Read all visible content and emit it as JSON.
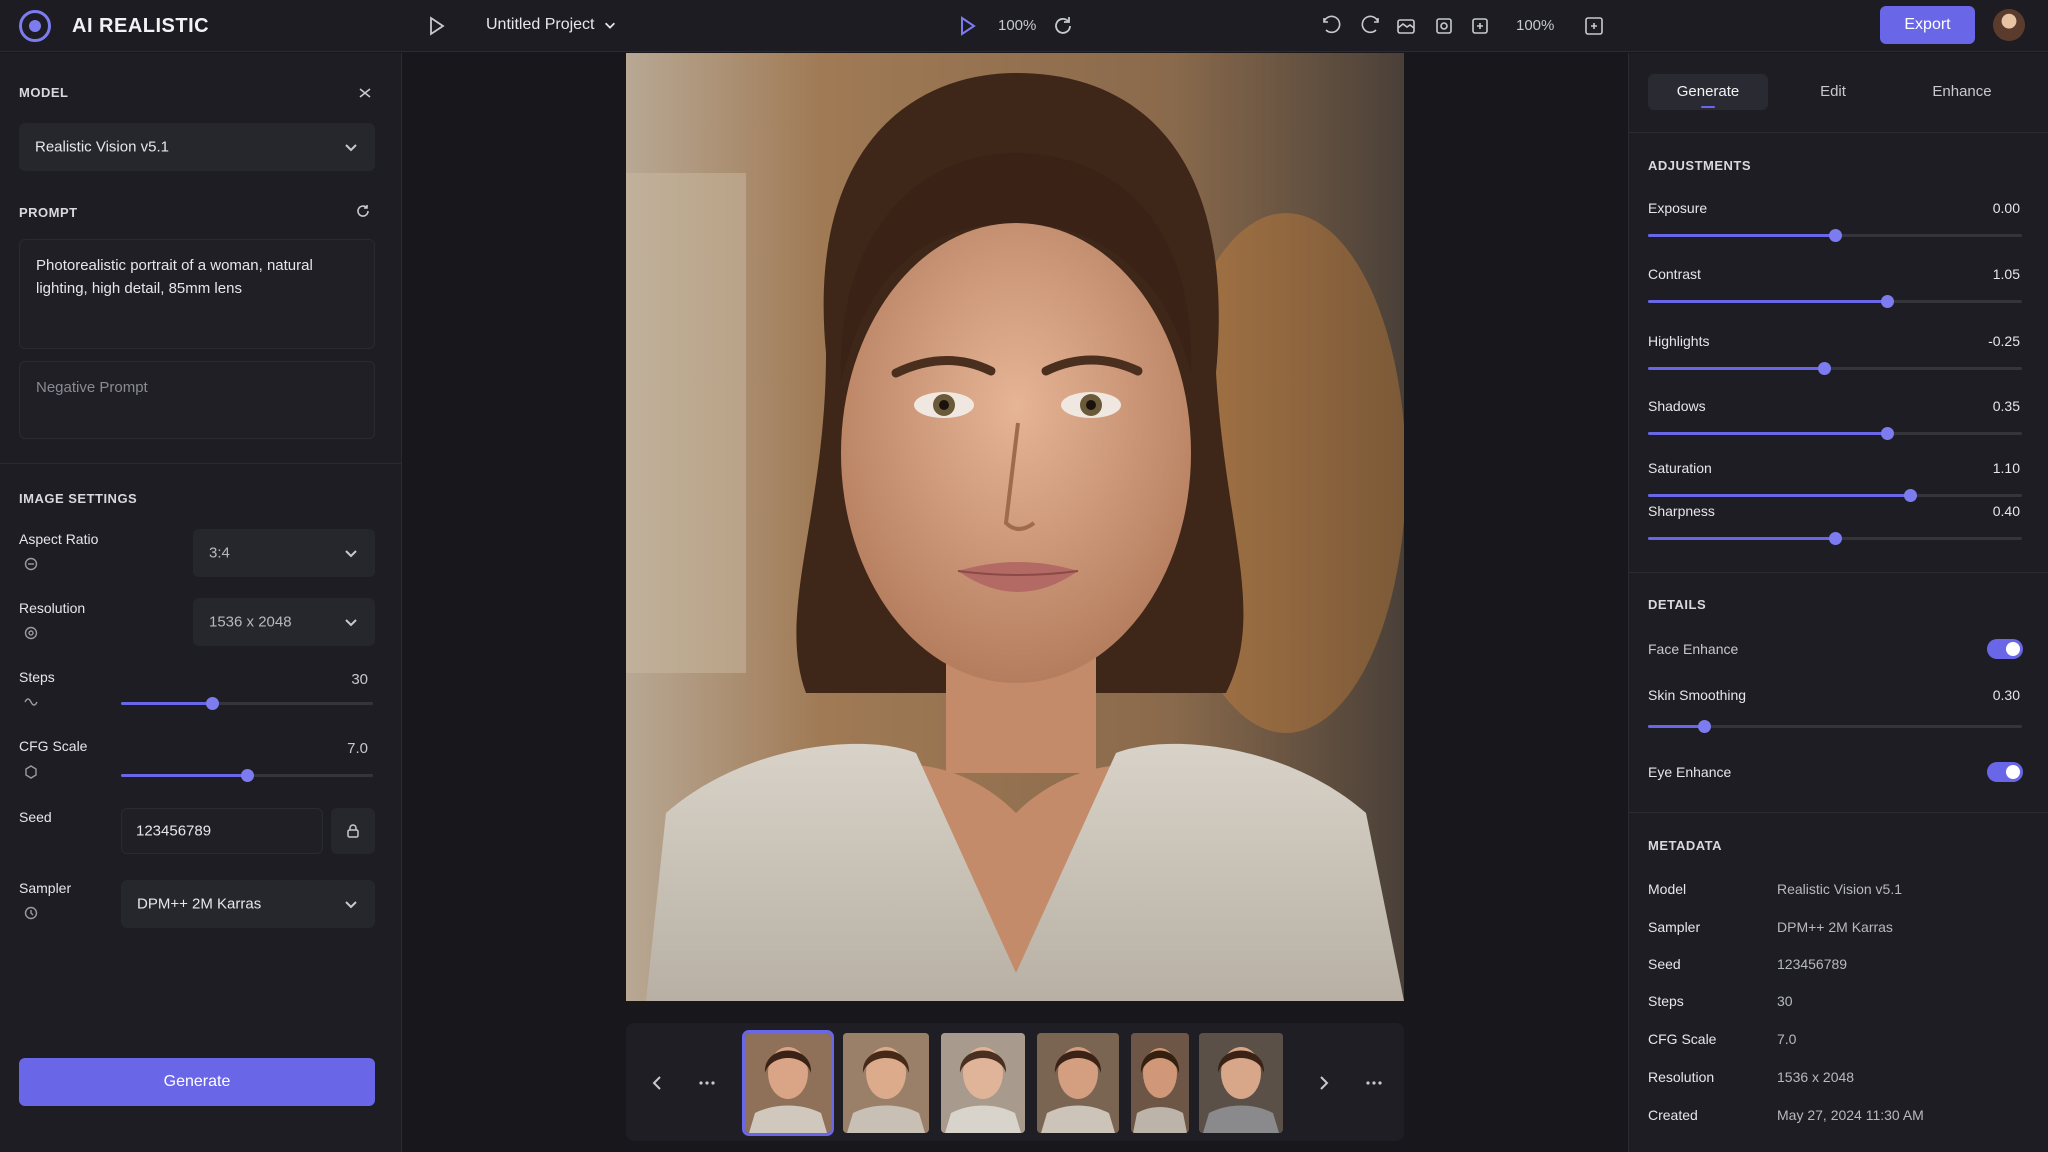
{
  "app": {
    "brand": "AI REALISTIC"
  },
  "topbar": {
    "project_name": "Untitled Project",
    "center_zoom": "100%",
    "right_zoom": "100%",
    "export_label": "Export"
  },
  "left": {
    "model_title": "MODEL",
    "model_value": "Realistic Vision v5.1",
    "prompt_title": "PROMPT",
    "prompt_text": "Photorealistic portrait of a woman, natural lighting, high detail, 85mm lens",
    "negative_placeholder": "Negative Prompt",
    "image_settings_title": "IMAGE SETTINGS",
    "aspect_label": "Aspect Ratio",
    "aspect_value": "3:4",
    "resolution_label": "Resolution",
    "resolution_value": "1536 x 2048",
    "steps_label": "Steps",
    "steps_value": "30",
    "steps_level": 0.36,
    "cfg_label": "CFG Scale",
    "cfg_value": "7.0",
    "cfg_level": 0.5,
    "seed_label": "Seed",
    "seed_value": "123456789",
    "sampler_label": "Sampler",
    "sampler_value": "DPM++ 2M Karras",
    "generate_label": "Generate"
  },
  "right": {
    "tabs": [
      "Generate",
      "Edit",
      "Enhance"
    ],
    "adjustments_title": "ADJUSTMENTS",
    "adjustments": [
      {
        "label": "Exposure",
        "value": "0.00",
        "level": 0.5
      },
      {
        "label": "Contrast",
        "value": "1.05",
        "level": 0.64
      },
      {
        "label": "Highlights",
        "value": "-0.25",
        "level": 0.47
      },
      {
        "label": "Shadows",
        "value": "0.35",
        "level": 0.64
      },
      {
        "label": "Saturation",
        "value": "1.10",
        "level": 0.7
      },
      {
        "label": "Sharpness",
        "value": "0.40",
        "level": 0.5
      }
    ],
    "details_title": "DETAILS",
    "face_enhance_label": "Face Enhance",
    "face_enhance_on": true,
    "skin_smoothing_label": "Skin Smoothing",
    "skin_smoothing_value": "0.30",
    "skin_smoothing_level": 0.15,
    "eye_enhance_label": "Eye Enhance",
    "eye_enhance_on": true,
    "metadata_title": "METADATA",
    "metadata": [
      {
        "key": "Model",
        "value": "Realistic Vision v5.1"
      },
      {
        "key": "Sampler",
        "value": "DPM++ 2M Karras"
      },
      {
        "key": "Seed",
        "value": "123456789"
      },
      {
        "key": "Steps",
        "value": "30"
      },
      {
        "key": "CFG Scale",
        "value": "7.0"
      },
      {
        "key": "Resolution",
        "value": "1536 x 2048"
      },
      {
        "key": "Created",
        "value": "May 27, 2024 11:30 AM"
      }
    ]
  },
  "colors": {
    "accent": "#6a66e8",
    "bg": "#17171c",
    "panel": "#1d1d23"
  },
  "icons": [
    "logo-icon",
    "play-icon",
    "chevron-down-icon",
    "redo-icon",
    "undo-icon",
    "crop-icon",
    "settings-icon",
    "lock-icon",
    "chevron-left-icon",
    "chevron-right-icon",
    "more-icon"
  ]
}
